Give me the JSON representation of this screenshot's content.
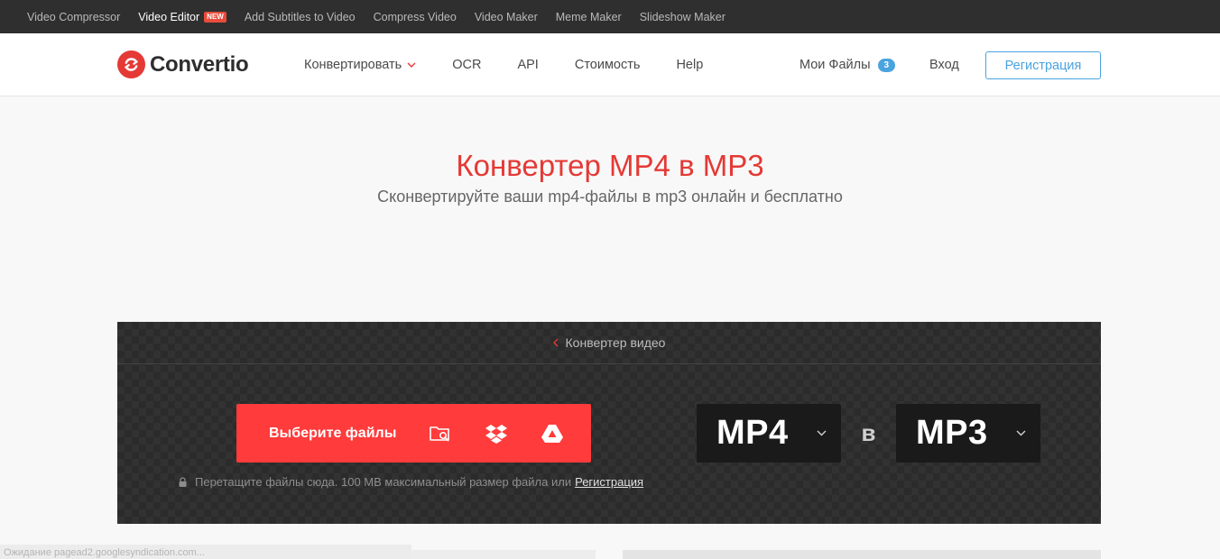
{
  "topbar": {
    "links": [
      {
        "label": "Video Compressor"
      },
      {
        "label": "Video Editor",
        "badge": "NEW"
      },
      {
        "label": "Add Subtitles to Video"
      },
      {
        "label": "Compress Video"
      },
      {
        "label": "Video Maker"
      },
      {
        "label": "Meme Maker"
      },
      {
        "label": "Slideshow Maker"
      }
    ]
  },
  "header": {
    "logo_text": "Convertio",
    "nav": [
      {
        "label": "Конвертировать"
      },
      {
        "label": "OCR"
      },
      {
        "label": "API"
      },
      {
        "label": "Стоимость"
      },
      {
        "label": "Help"
      }
    ],
    "my_files": {
      "label": "Мои Файлы",
      "count": "3"
    },
    "login": "Вход",
    "register": "Регистрация"
  },
  "hero": {
    "title": "Конвертер MP4 в MP3",
    "subtitle": "Сконвертируйте ваши mp4-файлы в mp3 онлайн и бесплатно"
  },
  "converter": {
    "breadcrumb": "Конвертер видео",
    "choose_files": "Выберите файлы",
    "source_icons": [
      "folder-search-icon",
      "dropbox-icon",
      "google-drive-icon"
    ],
    "hint_text": "Перетащите файлы сюда. 100 MB максимальный размер файла или",
    "hint_link": "Регистрация",
    "from_format": "MP4",
    "connector": "в",
    "to_format": "MP3"
  },
  "status_bar": {
    "text": "Ожидание pagead2.googlesyndication.com..."
  },
  "colors": {
    "brand_red": "#e53935",
    "button_red": "#ff3b3b",
    "accent_blue": "#4aa3df",
    "topbar_bg": "#2f2f2f",
    "box_bg": "#2b2b2b"
  }
}
